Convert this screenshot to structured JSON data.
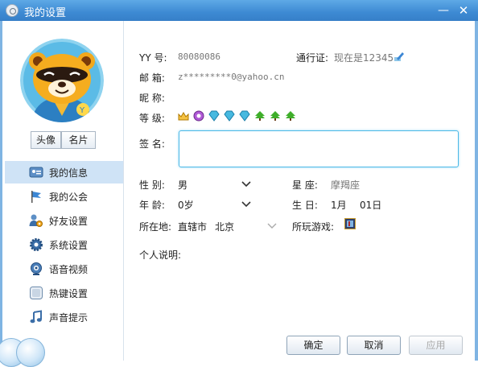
{
  "window": {
    "title": "我的设置",
    "min_symbol": "—",
    "close_symbol": "✕"
  },
  "left": {
    "avatar_button": "头像",
    "card_button": "名片",
    "nav": [
      {
        "label": "我的信息",
        "icon": "id-card-icon",
        "active": true
      },
      {
        "label": "我的公会",
        "icon": "flag-icon",
        "active": false
      },
      {
        "label": "好友设置",
        "icon": "friend-settings-icon",
        "active": false
      },
      {
        "label": "系统设置",
        "icon": "gear-icon",
        "active": false
      },
      {
        "label": "语音视频",
        "icon": "webcam-icon",
        "active": false
      },
      {
        "label": "热键设置",
        "icon": "hotkey-icon",
        "active": false
      },
      {
        "label": "声音提示",
        "icon": "music-note-icon",
        "active": false
      }
    ]
  },
  "profile": {
    "yy_label": "YY  号:",
    "yy_value": "80080086",
    "pass_label": "通行证:",
    "pass_value": "现在是12345",
    "email_label": "邮  箱:",
    "email_value": "z*********0@yahoo.cn",
    "nickname_label": "昵  称:",
    "nickname_value": "",
    "level_label": "等  级:",
    "level_icons": [
      "crown-icon",
      "moon-icon",
      "diamond-icon",
      "diamond-icon",
      "diamond-icon",
      "tree-icon",
      "tree-icon",
      "tree-icon"
    ],
    "signature_label": "签  名:",
    "signature_value": "",
    "gender_label": "性  别:",
    "gender_value": "男",
    "zodiac_label": "星  座:",
    "zodiac_value": "摩羯座",
    "age_label": "年  龄:",
    "age_value": "0岁",
    "birthday_label": "生  日:",
    "birth_month": "1月",
    "birth_day": "01日",
    "location_label": "所在地:",
    "location_province": "直辖市",
    "location_city": "北京",
    "games_label": "所玩游戏:",
    "bio_label": "个人说明:"
  },
  "buttons": {
    "ok": "确定",
    "cancel": "取消",
    "apply": "应用"
  },
  "colors": {
    "titlebar": "#3d8ad3",
    "accent": "#4bb8e6",
    "nav_active": "#cfe3f6"
  }
}
